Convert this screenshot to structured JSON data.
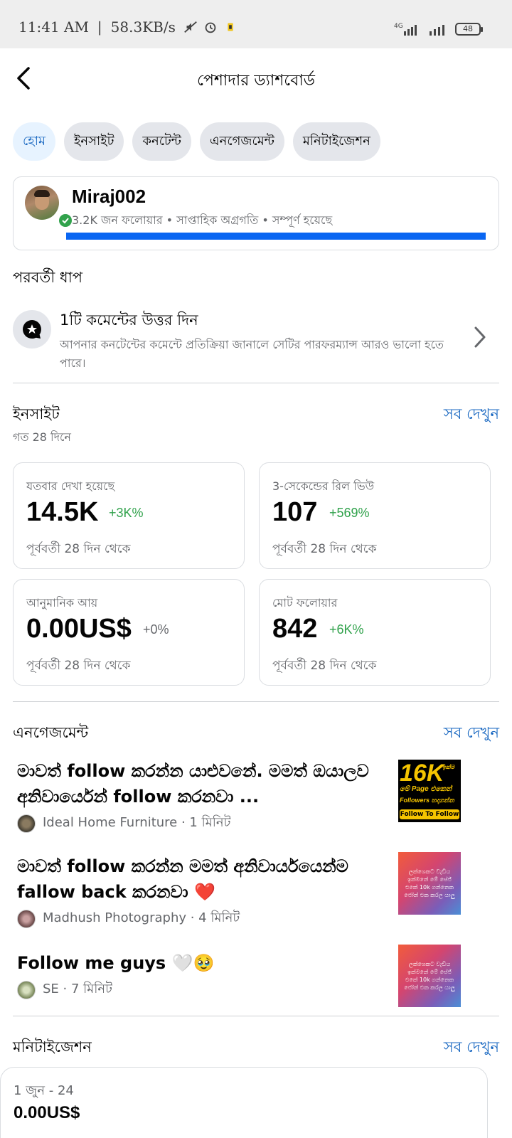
{
  "status_bar": {
    "time": "11:41 AM",
    "separator": "|",
    "speed": "58.3KB/s",
    "network": "4G",
    "battery": "48"
  },
  "header": {
    "title": "পেশাদার ড্যাশবোর্ড"
  },
  "tabs": [
    {
      "label": "হোম",
      "active": true
    },
    {
      "label": "ইনসাইট",
      "active": false
    },
    {
      "label": "কনটেন্ট",
      "active": false
    },
    {
      "label": "এনগেজমেন্ট",
      "active": false
    },
    {
      "label": "মনিটাইজেশন",
      "active": false
    }
  ],
  "profile": {
    "name": "Miraj002",
    "subtitle": "3.2K জন ফলোয়ার • সাপ্তাহিক অগ্রগতি • সম্পূর্ণ হয়েছে",
    "progress": 1.0
  },
  "next_step": {
    "section_title": "পরবর্তী ধাপ",
    "title": "1টি কমেন্টের উত্তর দিন",
    "description": "আপনার কনটেন্টের কমেন্টে প্রতিক্রিয়া জানালে সেটির পারফরম্যান্স আরও ভালো হতে পারে।"
  },
  "insights": {
    "title": "ইনসাইট",
    "see_all": "সব দেখুন",
    "period": "গত 28 দিনে",
    "metrics": [
      {
        "label": "যতবার দেখা হয়েছে",
        "value": "14.5K",
        "change": "+3K%",
        "change_color": "#31a24c",
        "footer": "পূর্ববর্তী 28 দিন থেকে"
      },
      {
        "label": "3-সেকেন্ডের রিল ভিউ",
        "value": "107",
        "change": "+569%",
        "change_color": "#31a24c",
        "footer": "পূর্ববর্তী 28 দিন থেকে"
      },
      {
        "label": "আনুমানিক আয়",
        "value": "0.00US$",
        "change": "+0%",
        "change_color": "#65676b",
        "footer": "পূর্ববর্তী 28 দিন থেকে"
      },
      {
        "label": "মোট ফলোয়ার",
        "value": "842",
        "change": "+6K%",
        "change_color": "#31a24c",
        "footer": "পূর্ববর্তী 28 দিন থেকে"
      }
    ]
  },
  "engagement": {
    "title": "এনগেজমেন্ট",
    "see_all": "সব দেখুন",
    "posts": [
      {
        "text": "මාවත්  follow කරන්න යාළුවනේ. මමත් ඔයාලව අනිවාර්යෙන් follow කරනවා ...",
        "author": "Ideal Home Furniture · 1 মিনিট",
        "thumb": "16k"
      },
      {
        "text": "මාවත් follow කරන්න මමත් අනිවාර්යයෙන්ම fallow back කරනවා ❤️",
        "author": "Madhush Photography · 4 মিনিট",
        "thumb": "grad"
      },
      {
        "text": "Follow me guys 🤍🥹",
        "author": "SE · 7 মিনিট",
        "thumb": "grad"
      }
    ],
    "thumb_16k": {
      "big": "16K",
      "suffix": "ඉක්ම",
      "line1": "මේ Page එකෙන්",
      "line2": "Followers හදාගන්න",
      "button": "Follow To Follow"
    },
    "thumb_grad_text": "ලක්ශෙකට වැඩිය ඉක්මනේ මේ පේජ් එකේ 10k ගන්නෙක ජෝන් එක කරල යාලු"
  },
  "monetization": {
    "title": "মনিটাইজেশন",
    "see_all": "সব দেখুন",
    "date_range": "1 জুন - 24",
    "value": "0.00US$"
  },
  "colors": {
    "accent": "#1565c0",
    "progress": "#0a66f2",
    "positive": "#31a24c"
  }
}
